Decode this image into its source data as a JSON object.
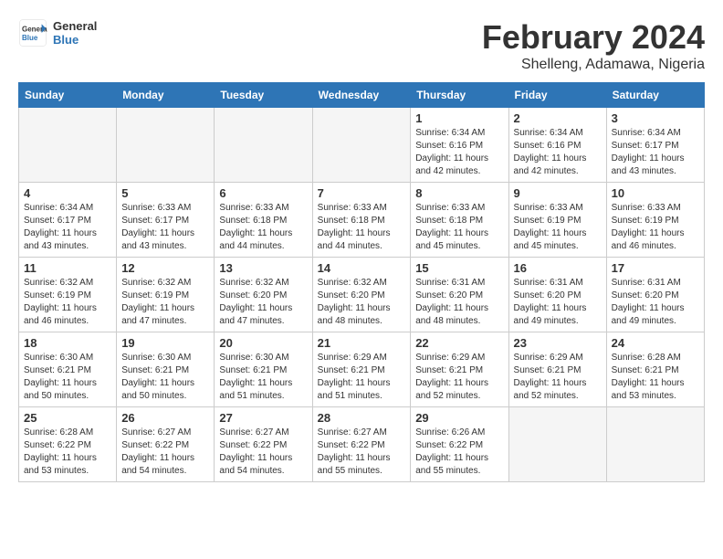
{
  "logo": {
    "text_general": "General",
    "text_blue": "Blue"
  },
  "title": {
    "month_year": "February 2024",
    "location": "Shelleng, Adamawa, Nigeria"
  },
  "weekdays": [
    "Sunday",
    "Monday",
    "Tuesday",
    "Wednesday",
    "Thursday",
    "Friday",
    "Saturday"
  ],
  "weeks": [
    [
      {
        "day": "",
        "sunrise": "",
        "sunset": "",
        "daylight": "",
        "empty": true
      },
      {
        "day": "",
        "sunrise": "",
        "sunset": "",
        "daylight": "",
        "empty": true
      },
      {
        "day": "",
        "sunrise": "",
        "sunset": "",
        "daylight": "",
        "empty": true
      },
      {
        "day": "",
        "sunrise": "",
        "sunset": "",
        "daylight": "",
        "empty": true
      },
      {
        "day": "1",
        "sunrise": "Sunrise: 6:34 AM",
        "sunset": "Sunset: 6:16 PM",
        "daylight": "Daylight: 11 hours and 42 minutes."
      },
      {
        "day": "2",
        "sunrise": "Sunrise: 6:34 AM",
        "sunset": "Sunset: 6:16 PM",
        "daylight": "Daylight: 11 hours and 42 minutes."
      },
      {
        "day": "3",
        "sunrise": "Sunrise: 6:34 AM",
        "sunset": "Sunset: 6:17 PM",
        "daylight": "Daylight: 11 hours and 43 minutes."
      }
    ],
    [
      {
        "day": "4",
        "sunrise": "Sunrise: 6:34 AM",
        "sunset": "Sunset: 6:17 PM",
        "daylight": "Daylight: 11 hours and 43 minutes."
      },
      {
        "day": "5",
        "sunrise": "Sunrise: 6:33 AM",
        "sunset": "Sunset: 6:17 PM",
        "daylight": "Daylight: 11 hours and 43 minutes."
      },
      {
        "day": "6",
        "sunrise": "Sunrise: 6:33 AM",
        "sunset": "Sunset: 6:18 PM",
        "daylight": "Daylight: 11 hours and 44 minutes."
      },
      {
        "day": "7",
        "sunrise": "Sunrise: 6:33 AM",
        "sunset": "Sunset: 6:18 PM",
        "daylight": "Daylight: 11 hours and 44 minutes."
      },
      {
        "day": "8",
        "sunrise": "Sunrise: 6:33 AM",
        "sunset": "Sunset: 6:18 PM",
        "daylight": "Daylight: 11 hours and 45 minutes."
      },
      {
        "day": "9",
        "sunrise": "Sunrise: 6:33 AM",
        "sunset": "Sunset: 6:19 PM",
        "daylight": "Daylight: 11 hours and 45 minutes."
      },
      {
        "day": "10",
        "sunrise": "Sunrise: 6:33 AM",
        "sunset": "Sunset: 6:19 PM",
        "daylight": "Daylight: 11 hours and 46 minutes."
      }
    ],
    [
      {
        "day": "11",
        "sunrise": "Sunrise: 6:32 AM",
        "sunset": "Sunset: 6:19 PM",
        "daylight": "Daylight: 11 hours and 46 minutes."
      },
      {
        "day": "12",
        "sunrise": "Sunrise: 6:32 AM",
        "sunset": "Sunset: 6:19 PM",
        "daylight": "Daylight: 11 hours and 47 minutes."
      },
      {
        "day": "13",
        "sunrise": "Sunrise: 6:32 AM",
        "sunset": "Sunset: 6:20 PM",
        "daylight": "Daylight: 11 hours and 47 minutes."
      },
      {
        "day": "14",
        "sunrise": "Sunrise: 6:32 AM",
        "sunset": "Sunset: 6:20 PM",
        "daylight": "Daylight: 11 hours and 48 minutes."
      },
      {
        "day": "15",
        "sunrise": "Sunrise: 6:31 AM",
        "sunset": "Sunset: 6:20 PM",
        "daylight": "Daylight: 11 hours and 48 minutes."
      },
      {
        "day": "16",
        "sunrise": "Sunrise: 6:31 AM",
        "sunset": "Sunset: 6:20 PM",
        "daylight": "Daylight: 11 hours and 49 minutes."
      },
      {
        "day": "17",
        "sunrise": "Sunrise: 6:31 AM",
        "sunset": "Sunset: 6:20 PM",
        "daylight": "Daylight: 11 hours and 49 minutes."
      }
    ],
    [
      {
        "day": "18",
        "sunrise": "Sunrise: 6:30 AM",
        "sunset": "Sunset: 6:21 PM",
        "daylight": "Daylight: 11 hours and 50 minutes."
      },
      {
        "day": "19",
        "sunrise": "Sunrise: 6:30 AM",
        "sunset": "Sunset: 6:21 PM",
        "daylight": "Daylight: 11 hours and 50 minutes."
      },
      {
        "day": "20",
        "sunrise": "Sunrise: 6:30 AM",
        "sunset": "Sunset: 6:21 PM",
        "daylight": "Daylight: 11 hours and 51 minutes."
      },
      {
        "day": "21",
        "sunrise": "Sunrise: 6:29 AM",
        "sunset": "Sunset: 6:21 PM",
        "daylight": "Daylight: 11 hours and 51 minutes."
      },
      {
        "day": "22",
        "sunrise": "Sunrise: 6:29 AM",
        "sunset": "Sunset: 6:21 PM",
        "daylight": "Daylight: 11 hours and 52 minutes."
      },
      {
        "day": "23",
        "sunrise": "Sunrise: 6:29 AM",
        "sunset": "Sunset: 6:21 PM",
        "daylight": "Daylight: 11 hours and 52 minutes."
      },
      {
        "day": "24",
        "sunrise": "Sunrise: 6:28 AM",
        "sunset": "Sunset: 6:21 PM",
        "daylight": "Daylight: 11 hours and 53 minutes."
      }
    ],
    [
      {
        "day": "25",
        "sunrise": "Sunrise: 6:28 AM",
        "sunset": "Sunset: 6:22 PM",
        "daylight": "Daylight: 11 hours and 53 minutes."
      },
      {
        "day": "26",
        "sunrise": "Sunrise: 6:27 AM",
        "sunset": "Sunset: 6:22 PM",
        "daylight": "Daylight: 11 hours and 54 minutes."
      },
      {
        "day": "27",
        "sunrise": "Sunrise: 6:27 AM",
        "sunset": "Sunset: 6:22 PM",
        "daylight": "Daylight: 11 hours and 54 minutes."
      },
      {
        "day": "28",
        "sunrise": "Sunrise: 6:27 AM",
        "sunset": "Sunset: 6:22 PM",
        "daylight": "Daylight: 11 hours and 55 minutes."
      },
      {
        "day": "29",
        "sunrise": "Sunrise: 6:26 AM",
        "sunset": "Sunset: 6:22 PM",
        "daylight": "Daylight: 11 hours and 55 minutes."
      },
      {
        "day": "",
        "sunrise": "",
        "sunset": "",
        "daylight": "",
        "empty": true
      },
      {
        "day": "",
        "sunrise": "",
        "sunset": "",
        "daylight": "",
        "empty": true
      }
    ]
  ]
}
